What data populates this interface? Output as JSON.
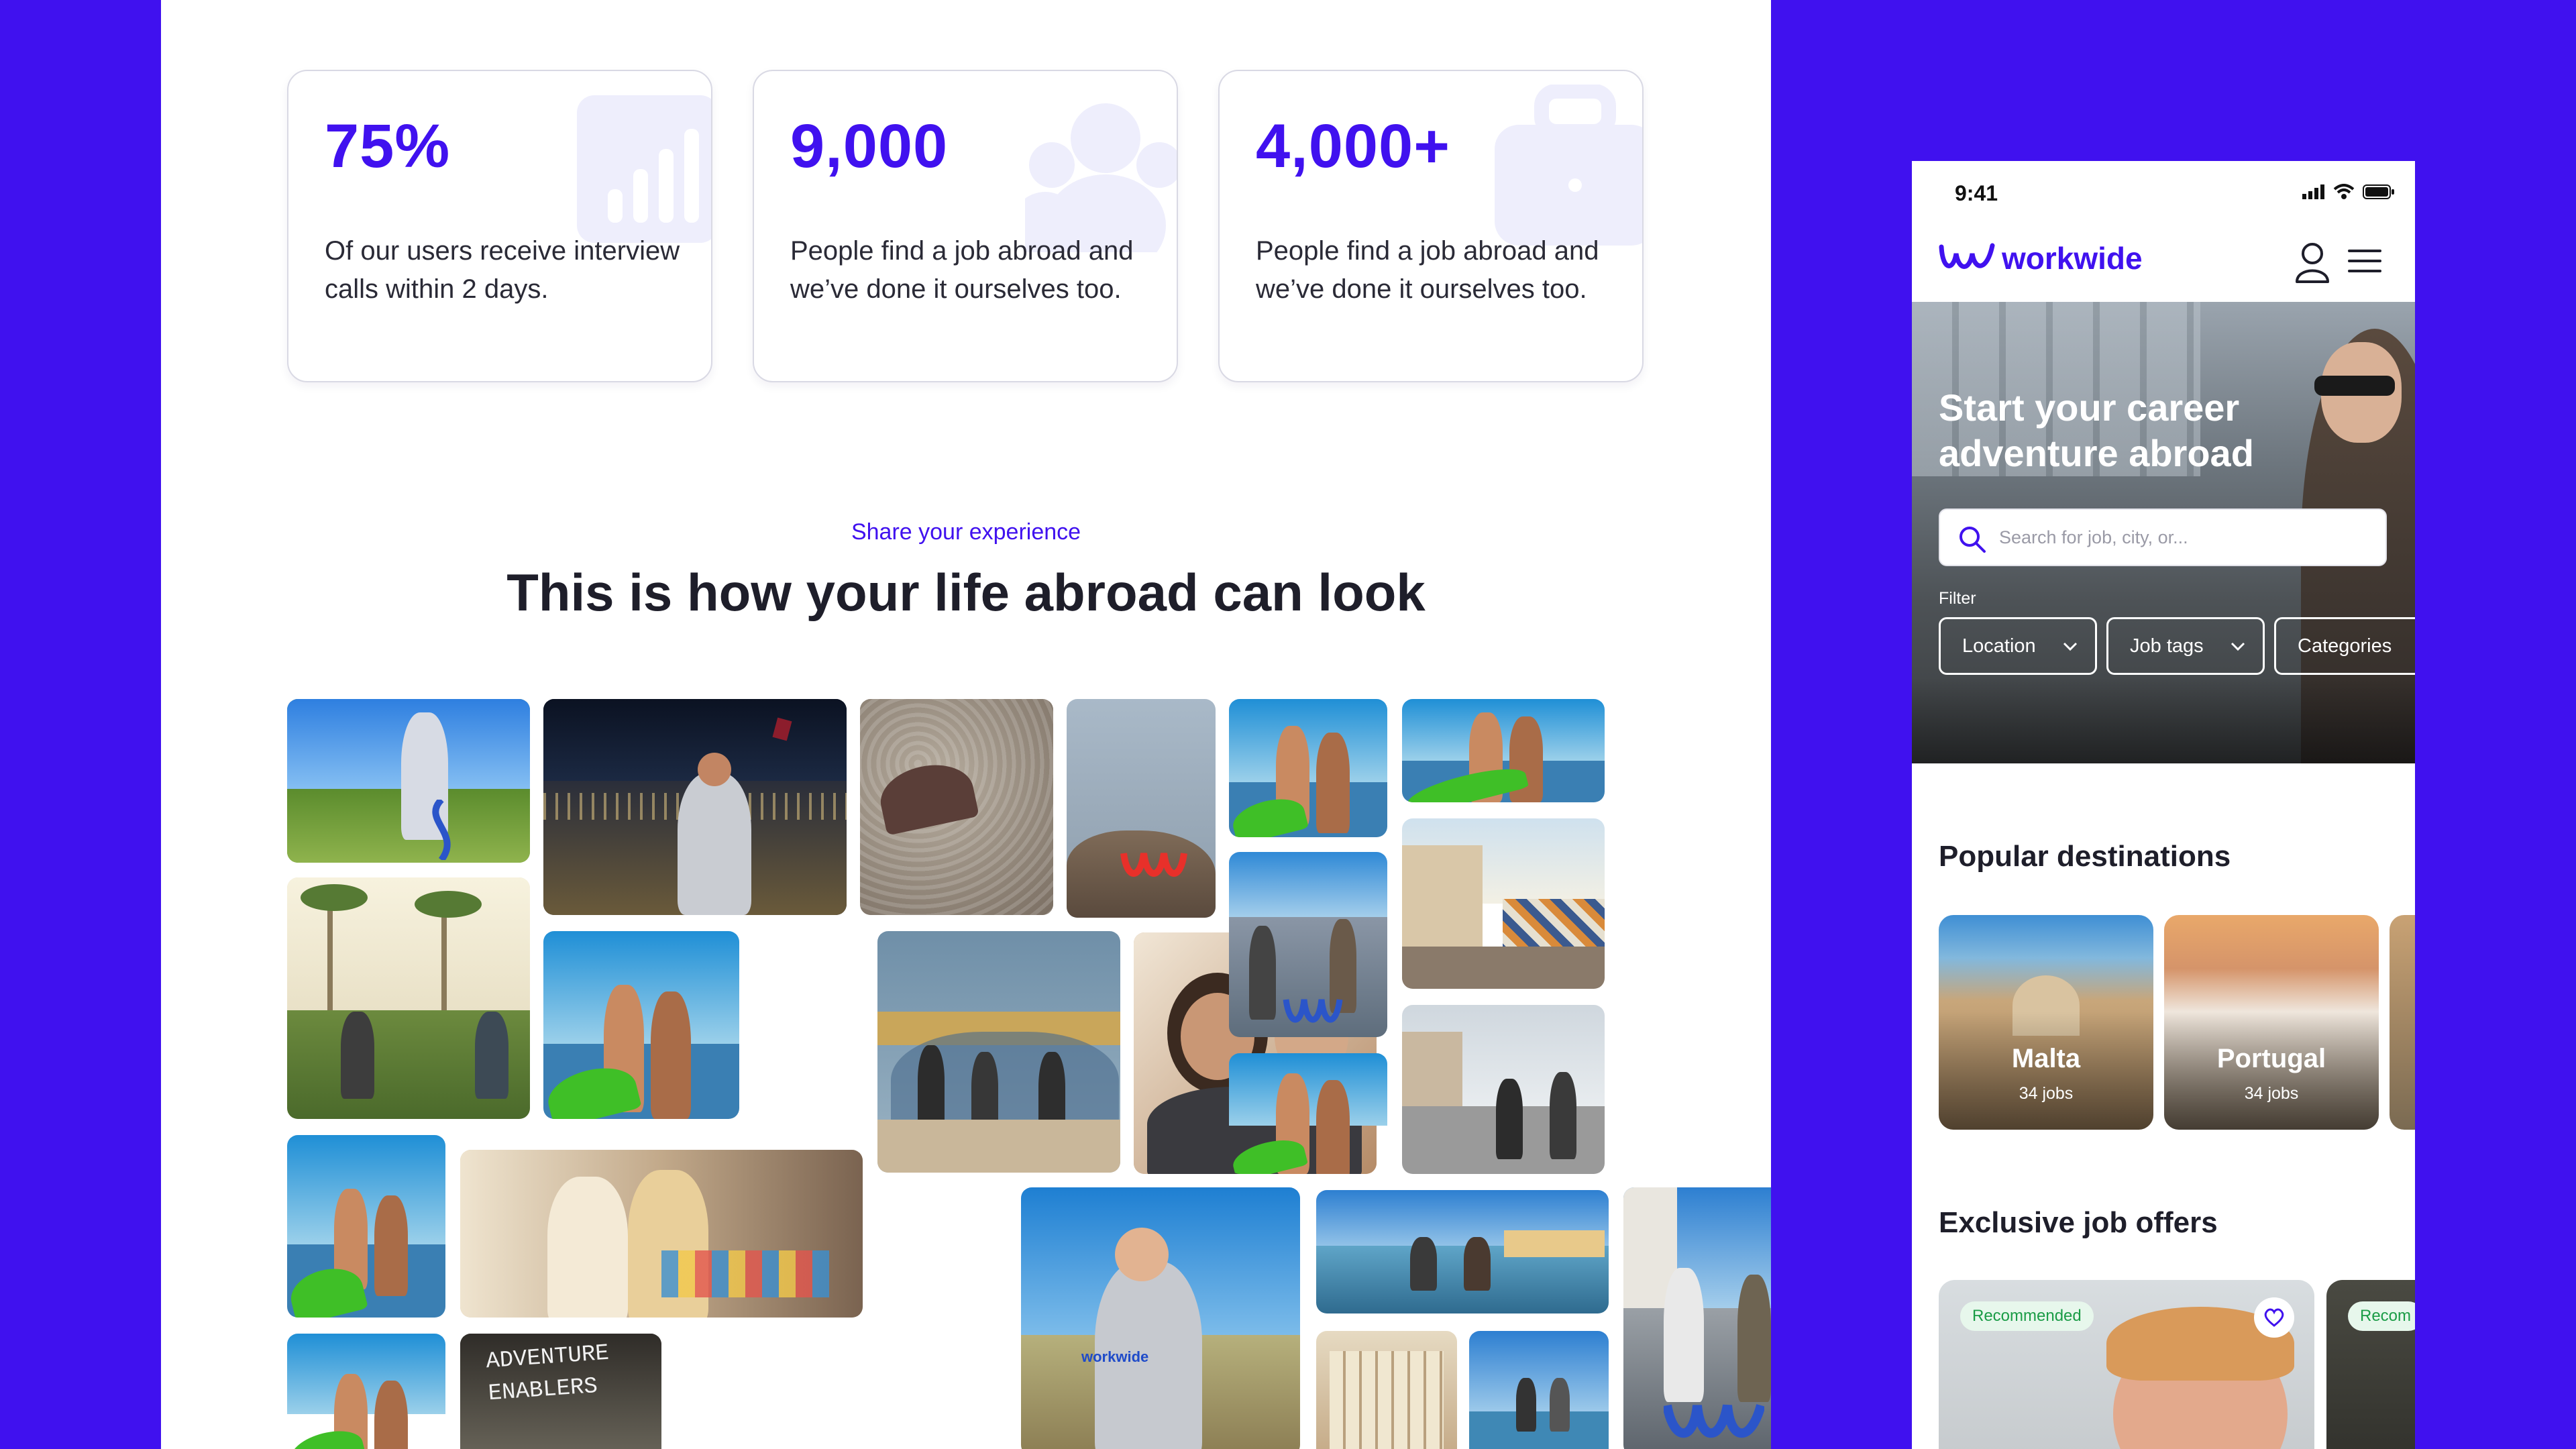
{
  "stats": [
    {
      "value": "75%",
      "description": "Of our users receive interview calls within 2 days.",
      "icon": "bar-chart-icon"
    },
    {
      "value": "9,000",
      "description": "People find a job abroad and we’ve done it ourselves too.",
      "icon": "people-group-icon"
    },
    {
      "value": "4,000+",
      "description": "People find a job abroad and we’ve done it ourselves too.",
      "icon": "briefcase-icon"
    }
  ],
  "gallery": {
    "eyebrow": "Share your experience",
    "title": "This is how your life abroad can look",
    "sign_text": "ADVENTURE ENABLERS",
    "shirt_text": "workwide"
  },
  "mobile": {
    "status_time": "9:41",
    "brand": "workwide",
    "hero_title": "Start your career adventure abroad",
    "search_placeholder": "Search for job, city, or...",
    "filter_label": "Filter",
    "filters": [
      "Location",
      "Job tags",
      "Categories"
    ],
    "popular_title": "Popular destinations",
    "destinations": [
      {
        "name": "Malta",
        "jobs": "34 jobs"
      },
      {
        "name": "Portugal",
        "jobs": "34 jobs"
      }
    ],
    "jobs_title": "Exclusive job offers",
    "job_badge": "Recommended",
    "job_badge_partial": "Recom"
  },
  "colors": {
    "brand": "#4011ef",
    "background": "#4011ef",
    "badge_green": "#1a9c46"
  }
}
